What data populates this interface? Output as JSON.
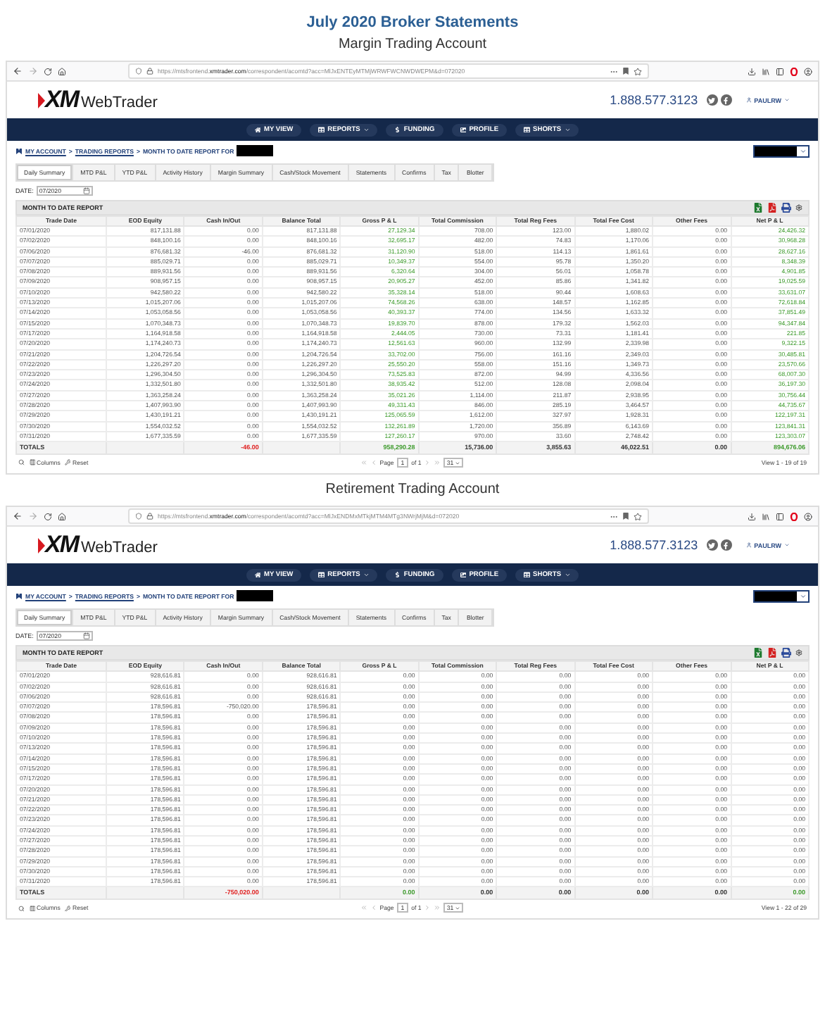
{
  "heading": "July 2020 Broker Statements",
  "panels": [
    {
      "subtitle": "Margin Trading Account",
      "browser": {
        "url": "https://mtsfrontend.**xmtrader.com**/correspondent/acomtd?acc=MlJxENTEyMTMjWRWFWCNWDWEPM&d=072020"
      },
      "site": {
        "logo_mark": "XM",
        "logo_name": "WebTrader",
        "phone": "1.888.577.3123",
        "user": "PAULRW"
      },
      "nav": [
        {
          "label": "MY VIEW",
          "kind": "home",
          "menu": false
        },
        {
          "label": "REPORTS",
          "kind": "grid",
          "menu": true
        },
        {
          "label": "FUNDING",
          "kind": "dollar",
          "menu": false
        },
        {
          "label": "PROFILE",
          "kind": "image",
          "menu": false
        },
        {
          "label": "SHORTS",
          "kind": "grid",
          "menu": true
        }
      ],
      "breadcrumb": {
        "links": [
          "MY ACCOUNT",
          "TRADING REPORTS"
        ],
        "separator": ">",
        "current": "MONTH TO DATE REPORT FOR"
      },
      "tabs": [
        {
          "label": "Daily Summary",
          "selected": true
        },
        {
          "label": "MTD P&L",
          "selected": false
        },
        {
          "label": "YTD P&L",
          "selected": false
        },
        {
          "label": "Activity History",
          "selected": false
        },
        {
          "label": "Margin Summary",
          "selected": false
        },
        {
          "label": "Cash/Stock Movement",
          "selected": false
        },
        {
          "label": "Statements",
          "selected": false
        },
        {
          "label": "Confirms",
          "selected": false
        },
        {
          "label": "Tax",
          "selected": false
        },
        {
          "label": "Blotter",
          "selected": false
        }
      ],
      "date": {
        "label": "DATE:",
        "value": "07/2020"
      },
      "report": {
        "title": "MONTH TO DATE REPORT",
        "columns": [
          {
            "label": "Trade Date",
            "kind": "date"
          },
          {
            "label": "EOD Equity",
            "kind": "amount"
          },
          {
            "label": "Cash In/Out",
            "kind": "amount"
          },
          {
            "label": "Balance Total",
            "kind": "amount"
          },
          {
            "label": "Gross P & L",
            "kind": "pnl"
          },
          {
            "label": "Total Commission",
            "kind": "amount"
          },
          {
            "label": "Total Reg Fees",
            "kind": "amount"
          },
          {
            "label": "Total Fee Cost",
            "kind": "amount"
          },
          {
            "label": "Other Fees",
            "kind": "amount"
          },
          {
            "label": "Net P & L",
            "kind": "pnl"
          }
        ],
        "rows": [
          [
            "07/01/2020",
            "817,131.88",
            "0.00",
            "817,131.88",
            "27,129.34",
            "708.00",
            "123.00",
            "1,880.02",
            "0.00",
            "24,426.32"
          ],
          [
            "07/02/2020",
            "848,100.16",
            "0.00",
            "848,100.16",
            "32,695.17",
            "482.00",
            "74.83",
            "1,170.06",
            "0.00",
            "30,968.28"
          ],
          [
            "07/06/2020",
            "876,681.32",
            "-46.00",
            "876,681.32",
            "31,120.90",
            "518.00",
            "114.13",
            "1,861.61",
            "0.00",
            "28,627.16"
          ],
          [
            "07/07/2020",
            "885,029.71",
            "0.00",
            "885,029.71",
            "10,349.37",
            "554.00",
            "95.78",
            "1,350.20",
            "0.00",
            "8,348.39"
          ],
          [
            "07/08/2020",
            "889,931.56",
            "0.00",
            "889,931.56",
            "6,320.64",
            "304.00",
            "56.01",
            "1,058.78",
            "0.00",
            "4,901.85"
          ],
          [
            "07/09/2020",
            "908,957.15",
            "0.00",
            "908,957.15",
            "20,905.27",
            "452.00",
            "85.86",
            "1,341.82",
            "0.00",
            "19,025.59"
          ],
          [
            "07/10/2020",
            "942,580.22",
            "0.00",
            "942,580.22",
            "35,328.14",
            "518.00",
            "90.44",
            "1,608.63",
            "0.00",
            "33,631.07"
          ],
          [
            "07/13/2020",
            "1,015,207.06",
            "0.00",
            "1,015,207.06",
            "74,568.26",
            "638.00",
            "148.57",
            "1,162.85",
            "0.00",
            "72,618.84"
          ],
          [
            "07/14/2020",
            "1,053,058.56",
            "0.00",
            "1,053,058.56",
            "40,393.37",
            "774.00",
            "134.56",
            "1,633.32",
            "0.00",
            "37,851.49"
          ],
          [
            "07/15/2020",
            "1,070,348.73",
            "0.00",
            "1,070,348.73",
            "19,839.70",
            "878.00",
            "179.32",
            "1,562.03",
            "0.00",
            "94,347.84"
          ],
          [
            "07/17/2020",
            "1,164,918.58",
            "0.00",
            "1,164,918.58",
            "2,444.05",
            "730.00",
            "73.31",
            "1,181.41",
            "0.00",
            "221.85"
          ],
          [
            "07/20/2020",
            "1,174,240.73",
            "0.00",
            "1,174,240.73",
            "12,561.63",
            "960.00",
            "132.99",
            "2,339.98",
            "0.00",
            "9,322.15"
          ],
          [
            "07/21/2020",
            "1,204,726.54",
            "0.00",
            "1,204,726.54",
            "33,702.00",
            "756.00",
            "161.16",
            "2,349.03",
            "0.00",
            "30,485.81"
          ],
          [
            "07/22/2020",
            "1,226,297.20",
            "0.00",
            "1,226,297.20",
            "25,550.20",
            "558.00",
            "151.16",
            "1,349.73",
            "0.00",
            "23,570.66"
          ],
          [
            "07/23/2020",
            "1,296,304.50",
            "0.00",
            "1,296,304.50",
            "73,525.83",
            "872.00",
            "94.99",
            "4,336.56",
            "0.00",
            "68,007.30"
          ],
          [
            "07/24/2020",
            "1,332,501.80",
            "0.00",
            "1,332,501.80",
            "38,935.42",
            "512.00",
            "128.08",
            "2,098.04",
            "0.00",
            "36,197.30"
          ],
          [
            "07/27/2020",
            "1,363,258.24",
            "0.00",
            "1,363,258.24",
            "35,021.26",
            "1,114.00",
            "211.87",
            "2,938.95",
            "0.00",
            "30,756.44"
          ],
          [
            "07/28/2020",
            "1,407,993.90",
            "0.00",
            "1,407,993.90",
            "49,331.43",
            "846.00",
            "285.19",
            "3,464.57",
            "0.00",
            "44,735.67"
          ],
          [
            "07/29/2020",
            "1,430,191.21",
            "0.00",
            "1,430,191.21",
            "125,065.59",
            "1,612.00",
            "327.97",
            "1,928.31",
            "0.00",
            "122,197.31"
          ],
          [
            "07/30/2020",
            "1,554,032.52",
            "0.00",
            "1,554,032.52",
            "132,261.89",
            "1,720.00",
            "356.89",
            "6,143.69",
            "0.00",
            "123,841.31"
          ],
          [
            "07/31/2020",
            "1,677,335.59",
            "0.00",
            "1,677,335.59",
            "127,260.17",
            "970.00",
            "33.60",
            "2,748.42",
            "0.00",
            "123,303.07"
          ]
        ],
        "totals": [
          {
            "text": "TOTALS",
            "kind": "label"
          },
          {
            "kind": "blank"
          },
          {
            "text": "-46.00",
            "kind": "loss"
          },
          {
            "kind": "blank"
          },
          {
            "text": "958,290.28",
            "kind": "gain"
          },
          {
            "text": "15,736.00",
            "kind": "plain"
          },
          {
            "text": "3,855.63",
            "kind": "plain"
          },
          {
            "text": "46,022.51",
            "kind": "plain"
          },
          {
            "text": "0.00",
            "kind": "plain"
          },
          {
            "text": "894,676.06",
            "kind": "gain"
          }
        ],
        "tools": [
          "Columns",
          "Reset"
        ],
        "pager": {
          "page_label": "Page",
          "page": "1",
          "of": "of 1",
          "per_page": "31"
        },
        "view": "View 1 - 19 of 19"
      }
    },
    {
      "subtitle": "Retirement Trading Account",
      "browser": {
        "url": "https://mtsfrontend.**xmtrader.com**/correspondent/acomtd?acc=MlJxENDMxMTkjMTM4MTg3NWrjMjM&d=072020"
      },
      "site": {
        "logo_mark": "XM",
        "logo_name": "WebTrader",
        "phone": "1.888.577.3123",
        "user": "PAULRW"
      },
      "nav": [
        {
          "label": "MY VIEW",
          "kind": "home",
          "menu": false
        },
        {
          "label": "REPORTS",
          "kind": "grid",
          "menu": true
        },
        {
          "label": "FUNDING",
          "kind": "dollar",
          "menu": false
        },
        {
          "label": "PROFILE",
          "kind": "image",
          "menu": false
        },
        {
          "label": "SHORTS",
          "kind": "grid",
          "menu": true
        }
      ],
      "breadcrumb": {
        "links": [
          "MY ACCOUNT",
          "TRADING REPORTS"
        ],
        "separator": ">",
        "current": "MONTH TO DATE REPORT FOR"
      },
      "tabs": [
        {
          "label": "Daily Summary",
          "selected": true
        },
        {
          "label": "MTD P&L",
          "selected": false
        },
        {
          "label": "YTD P&L",
          "selected": false
        },
        {
          "label": "Activity History",
          "selected": false
        },
        {
          "label": "Margin Summary",
          "selected": false
        },
        {
          "label": "Cash/Stock Movement",
          "selected": false
        },
        {
          "label": "Statements",
          "selected": false
        },
        {
          "label": "Confirms",
          "selected": false
        },
        {
          "label": "Tax",
          "selected": false
        },
        {
          "label": "Blotter",
          "selected": false
        }
      ],
      "date": {
        "label": "DATE:",
        "value": "07/2020"
      },
      "report": {
        "title": "MONTH TO DATE REPORT",
        "columns": [
          {
            "label": "Trade Date",
            "kind": "date"
          },
          {
            "label": "EOD Equity",
            "kind": "amount"
          },
          {
            "label": "Cash In/Out",
            "kind": "amount"
          },
          {
            "label": "Balance Total",
            "kind": "amount"
          },
          {
            "label": "Gross P & L",
            "kind": "amount"
          },
          {
            "label": "Total Commission",
            "kind": "amount"
          },
          {
            "label": "Total Reg Fees",
            "kind": "amount"
          },
          {
            "label": "Total Fee Cost",
            "kind": "amount"
          },
          {
            "label": "Other Fees",
            "kind": "amount"
          },
          {
            "label": "Net P & L",
            "kind": "amount"
          }
        ],
        "rows": [
          [
            "07/01/2020",
            "928,616.81",
            "0.00",
            "928,616.81",
            "0.00",
            "0.00",
            "0.00",
            "0.00",
            "0.00",
            "0.00"
          ],
          [
            "07/02/2020",
            "928,616.81",
            "0.00",
            "928,616.81",
            "0.00",
            "0.00",
            "0.00",
            "0.00",
            "0.00",
            "0.00"
          ],
          [
            "07/06/2020",
            "928,616.81",
            "0.00",
            "928,616.81",
            "0.00",
            "0.00",
            "0.00",
            "0.00",
            "0.00",
            "0.00"
          ],
          [
            "07/07/2020",
            "178,596.81",
            "-750,020.00",
            "178,596.81",
            "0.00",
            "0.00",
            "0.00",
            "0.00",
            "0.00",
            "0.00"
          ],
          [
            "07/08/2020",
            "178,596.81",
            "0.00",
            "178,596.81",
            "0.00",
            "0.00",
            "0.00",
            "0.00",
            "0.00",
            "0.00"
          ],
          [
            "07/09/2020",
            "178,596.81",
            "0.00",
            "178,596.81",
            "0.00",
            "0.00",
            "0.00",
            "0.00",
            "0.00",
            "0.00"
          ],
          [
            "07/10/2020",
            "178,596.81",
            "0.00",
            "178,596.81",
            "0.00",
            "0.00",
            "0.00",
            "0.00",
            "0.00",
            "0.00"
          ],
          [
            "07/13/2020",
            "178,596.81",
            "0.00",
            "178,596.81",
            "0.00",
            "0.00",
            "0.00",
            "0.00",
            "0.00",
            "0.00"
          ],
          [
            "07/14/2020",
            "178,596.81",
            "0.00",
            "178,596.81",
            "0.00",
            "0.00",
            "0.00",
            "0.00",
            "0.00",
            "0.00"
          ],
          [
            "07/15/2020",
            "178,596.81",
            "0.00",
            "178,596.81",
            "0.00",
            "0.00",
            "0.00",
            "0.00",
            "0.00",
            "0.00"
          ],
          [
            "07/17/2020",
            "178,596.81",
            "0.00",
            "178,596.81",
            "0.00",
            "0.00",
            "0.00",
            "0.00",
            "0.00",
            "0.00"
          ],
          [
            "07/20/2020",
            "178,596.81",
            "0.00",
            "178,596.81",
            "0.00",
            "0.00",
            "0.00",
            "0.00",
            "0.00",
            "0.00"
          ],
          [
            "07/21/2020",
            "178,596.81",
            "0.00",
            "178,596.81",
            "0.00",
            "0.00",
            "0.00",
            "0.00",
            "0.00",
            "0.00"
          ],
          [
            "07/22/2020",
            "178,596.81",
            "0.00",
            "178,596.81",
            "0.00",
            "0.00",
            "0.00",
            "0.00",
            "0.00",
            "0.00"
          ],
          [
            "07/23/2020",
            "178,596.81",
            "0.00",
            "178,596.81",
            "0.00",
            "0.00",
            "0.00",
            "0.00",
            "0.00",
            "0.00"
          ],
          [
            "07/24/2020",
            "178,596.81",
            "0.00",
            "178,596.81",
            "0.00",
            "0.00",
            "0.00",
            "0.00",
            "0.00",
            "0.00"
          ],
          [
            "07/27/2020",
            "178,596.81",
            "0.00",
            "178,596.81",
            "0.00",
            "0.00",
            "0.00",
            "0.00",
            "0.00",
            "0.00"
          ],
          [
            "07/28/2020",
            "178,596.81",
            "0.00",
            "178,596.81",
            "0.00",
            "0.00",
            "0.00",
            "0.00",
            "0.00",
            "0.00"
          ],
          [
            "07/29/2020",
            "178,596.81",
            "0.00",
            "178,596.81",
            "0.00",
            "0.00",
            "0.00",
            "0.00",
            "0.00",
            "0.00"
          ],
          [
            "07/30/2020",
            "178,596.81",
            "0.00",
            "178,596.81",
            "0.00",
            "0.00",
            "0.00",
            "0.00",
            "0.00",
            "0.00"
          ],
          [
            "07/31/2020",
            "178,596.81",
            "0.00",
            "178,596.81",
            "0.00",
            "0.00",
            "0.00",
            "0.00",
            "0.00",
            "0.00"
          ]
        ],
        "totals": [
          {
            "text": "TOTALS",
            "kind": "label"
          },
          {
            "kind": "blank"
          },
          {
            "text": "-750,020.00",
            "kind": "loss"
          },
          {
            "kind": "blank"
          },
          {
            "text": "0.00",
            "kind": "gain"
          },
          {
            "text": "0.00",
            "kind": "plain"
          },
          {
            "text": "0.00",
            "kind": "plain"
          },
          {
            "text": "0.00",
            "kind": "plain"
          },
          {
            "text": "0.00",
            "kind": "plain"
          },
          {
            "text": "0.00",
            "kind": "gain"
          }
        ],
        "tools": [
          "Columns",
          "Reset"
        ],
        "pager": {
          "page_label": "Page",
          "page": "1",
          "of": "of 1",
          "per_page": "31"
        },
        "view": "View 1 - 22 of 29"
      }
    }
  ]
}
